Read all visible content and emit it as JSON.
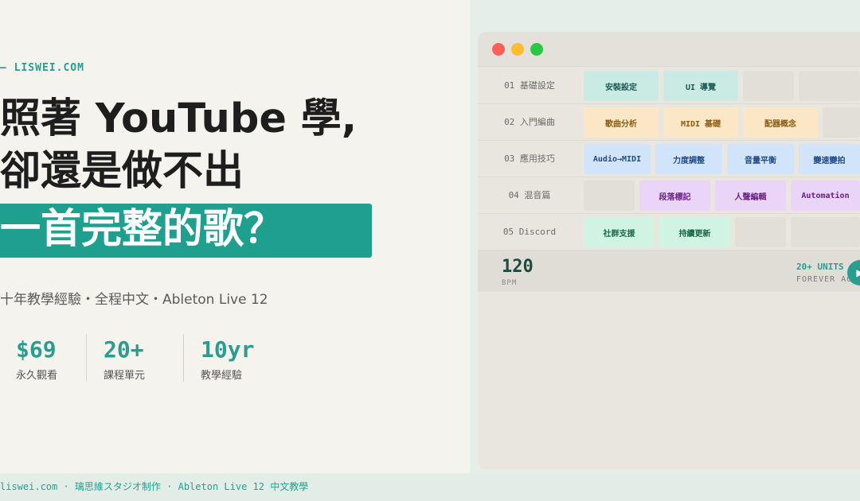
{
  "brand": {
    "text": "— LISWEI.COM"
  },
  "headline": {
    "line1": "照著 YouTube 學,",
    "line2": "卻還是做不出",
    "line3": "一首完整的歌？"
  },
  "subtitle": "十年教學經驗・全程中文・Ableton Live 12",
  "stats": [
    {
      "value": "$69",
      "label": "永久觀看"
    },
    {
      "value": "20+",
      "label": "課程單元"
    },
    {
      "value": "10yr",
      "label": "教學經驗"
    }
  ],
  "window": {
    "tracks": [
      {
        "label": "01 基礎設定",
        "clips": [
          "安裝設定",
          "UI 導覽"
        ]
      },
      {
        "label": "02 入門編曲",
        "clips": [
          "歌曲分析",
          "MIDI 基礎",
          "配器概念"
        ]
      },
      {
        "label": "03 應用技巧",
        "clips": [
          "Audio→MIDI",
          "力度調整",
          "音量平衡",
          "變速變拍"
        ]
      },
      {
        "label": "04 混音篇",
        "clips": [
          "段落標記",
          "人聲編輯",
          "Automation"
        ]
      },
      {
        "label": "05 Discord",
        "clips": [
          "社群支援",
          "持續更新"
        ]
      }
    ],
    "transport": {
      "bpm_value": "120",
      "bpm_label": "BPM",
      "units_value": "20+ UNITS",
      "units_label": "FOREVER ACCESS"
    }
  },
  "footer": {
    "text": "liswei.com · 璃思維スタジオ制作 · Ableton Live 12 中文教學"
  },
  "colors": {
    "accent": "#2a9d8f",
    "highlight": "#1fa08e",
    "dot_red": "#fe5f57",
    "dot_yellow": "#febc2e",
    "dot_green": "#28c840"
  },
  "icons": {
    "play": "play-icon"
  }
}
